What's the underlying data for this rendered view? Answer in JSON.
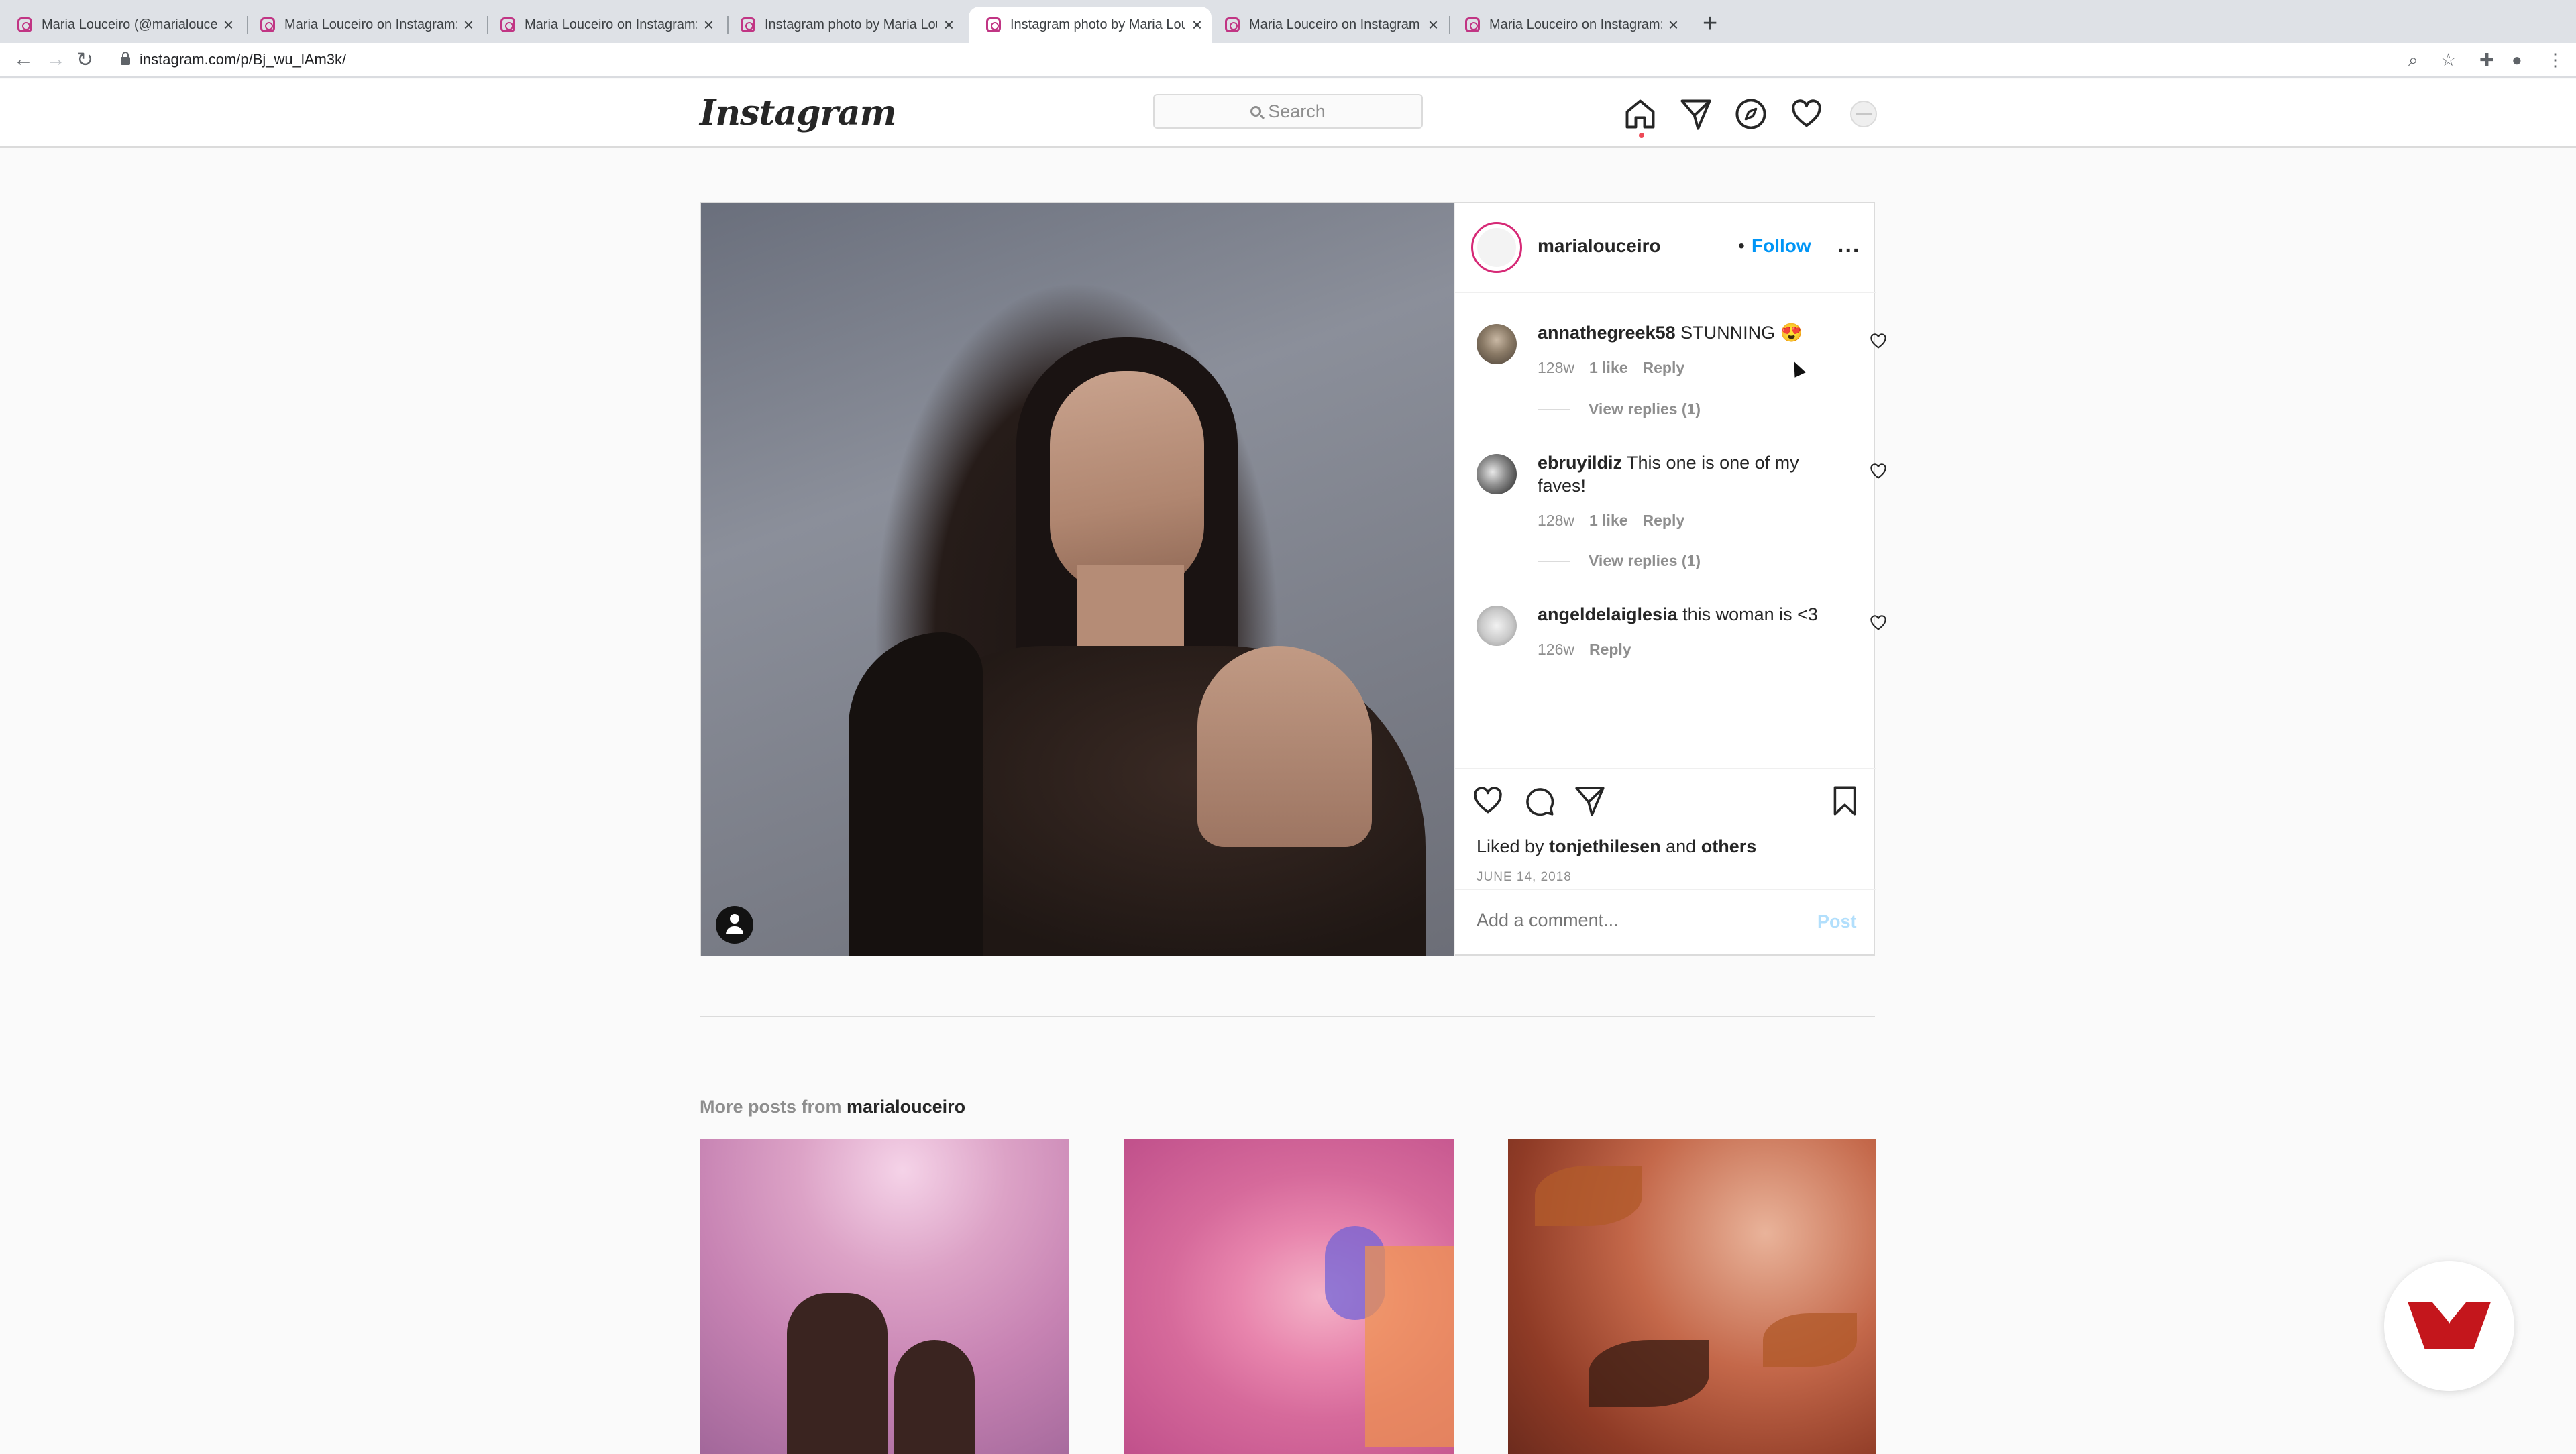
{
  "browser": {
    "tabs": [
      {
        "title": "Maria Louceiro (@marialouceiro) • Instagram photos and videos",
        "active": false
      },
      {
        "title": "Maria Louceiro on Instagram: \"",
        "active": false
      },
      {
        "title": "Maria Louceiro on Instagram: \"",
        "active": false
      },
      {
        "title": "Instagram photo by Maria Louceiro",
        "active": false
      },
      {
        "title": "Instagram photo by Maria Louceiro",
        "active": true
      },
      {
        "title": "Maria Louceiro on Instagram: \"",
        "active": false
      },
      {
        "title": "Maria Louceiro on Instagram: \"",
        "active": false
      }
    ],
    "close_glyph": "×",
    "new_tab_glyph": "+",
    "url": "instagram.com/p/Bj_wu_lAm3k/"
  },
  "header": {
    "logo": "Instagram",
    "search_placeholder": "Search",
    "icons": [
      "home-icon",
      "direct-icon",
      "explore-icon",
      "activity-icon",
      "profile-avatar"
    ]
  },
  "post": {
    "username": "marialouceiro",
    "follow_sep": "•",
    "follow_label": "Follow",
    "more_label": "...",
    "comments": [
      {
        "user": "annathegreek58",
        "text": "STUNNING 😍",
        "age": "128w",
        "likes": "1 like",
        "reply": "Reply",
        "view_replies": "View replies (1)"
      },
      {
        "user": "ebruyildiz",
        "text": "This one is one of my faves!",
        "age": "128w",
        "likes": "1 like",
        "reply": "Reply",
        "view_replies": "View replies (1)"
      },
      {
        "user": "angeldelaiglesia",
        "text": "this woman is <3",
        "age": "126w",
        "reply": "Reply"
      }
    ],
    "liked_by_prefix": "Liked by",
    "liked_by_user": "tonjethilesen",
    "liked_by_and": "and",
    "liked_by_others": "others",
    "date": "JUNE 14, 2018",
    "add_comment_placeholder": "Add a comment...",
    "post_button": "Post"
  },
  "more_posts": {
    "label": "More posts from",
    "user": "marialouceiro"
  },
  "colors": {
    "link_blue": "#0095f6",
    "post_disabled": "#b2dffc",
    "notification_dot": "#ed4956"
  }
}
